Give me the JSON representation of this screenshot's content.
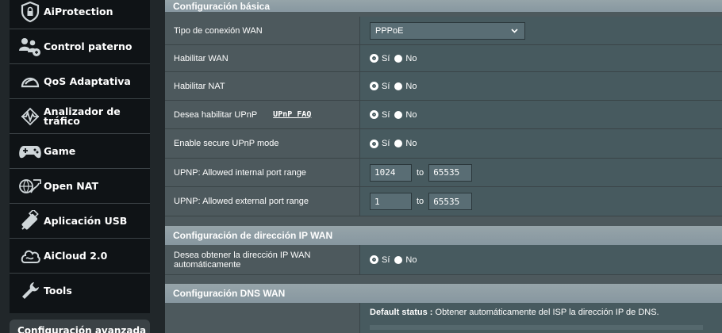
{
  "sidebar": {
    "items": [
      {
        "label": "AiProtection",
        "icon": "shield-lock-icon"
      },
      {
        "label": "Control paterno",
        "icon": "family-icon"
      },
      {
        "label": "QoS Adaptativa",
        "icon": "speedometer-icon"
      },
      {
        "label": "Analizador de tráfico",
        "icon": "traffic-analyzer-icon"
      },
      {
        "label": "Game",
        "icon": "gamepad-icon"
      },
      {
        "label": "Open NAT",
        "icon": "open-nat-icon"
      },
      {
        "label": "Aplicación USB",
        "icon": "usb-icon"
      },
      {
        "label": "AiCloud 2.0",
        "icon": "cloud-icon"
      },
      {
        "label": "Tools",
        "icon": "wrench-icon"
      }
    ],
    "advanced_header": "Configuración avanzada"
  },
  "basic": {
    "title": "Configuración básica",
    "wan_type_label": "Tipo de conexión WAN",
    "wan_type_value": "PPPoE",
    "enable_wan_label": "Habilitar WAN",
    "enable_nat_label": "Habilitar NAT",
    "upnp_label": "Desea habilitar UPnP",
    "upnp_faq": "UPnP FAQ",
    "secure_upnp_label": "Enable secure UPnP mode",
    "internal_range_label": "UPNP: Allowed internal port range",
    "internal_from": "1024",
    "internal_to": "65535",
    "external_range_label": "UPNP: Allowed external port range",
    "external_from": "1",
    "external_to": "65535",
    "to_label": "to",
    "yes": "Sí",
    "no": "No"
  },
  "wanip": {
    "title": "Configuración de dirección IP WAN",
    "auto_ip_label": "Desea obtener la dirección IP WAN automáticamente"
  },
  "dns": {
    "title": "Configuración DNS WAN",
    "default_status_label": "Default status :",
    "default_status_value": "Obtener automáticamente del ISP la dirección IP de DNS."
  }
}
